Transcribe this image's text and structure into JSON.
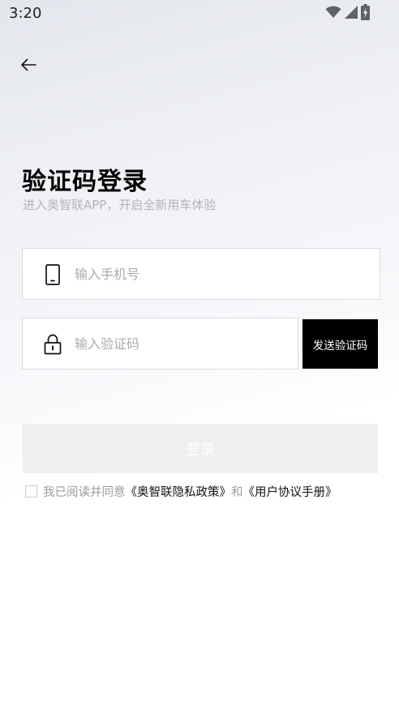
{
  "status_bar": {
    "time": "3:20",
    "icons": [
      "wifi-icon",
      "signal-icon",
      "battery-charging-icon"
    ]
  },
  "header": {
    "back_icon": "arrow-left-icon"
  },
  "title": "验证码登录",
  "subtitle": "进入奥智联APP，开启全新用车体验",
  "phone_field": {
    "icon": "phone-icon",
    "placeholder": "输入手机号",
    "value": ""
  },
  "code_field": {
    "icon": "lock-icon",
    "placeholder": "输入验证码",
    "value": ""
  },
  "send_code_label": "发送验证码",
  "login_label": "登录",
  "agreement": {
    "checked": false,
    "prefix": "我已阅读并同意",
    "privacy_link": "《奥智联隐私政策》",
    "conjunction": "和",
    "terms_link": "《用户协议手册》"
  },
  "colors": {
    "accent": "#000000",
    "login_disabled_bg": "#eeeff1",
    "placeholder": "#a9abb0",
    "subtitle": "#b2b4b8"
  }
}
